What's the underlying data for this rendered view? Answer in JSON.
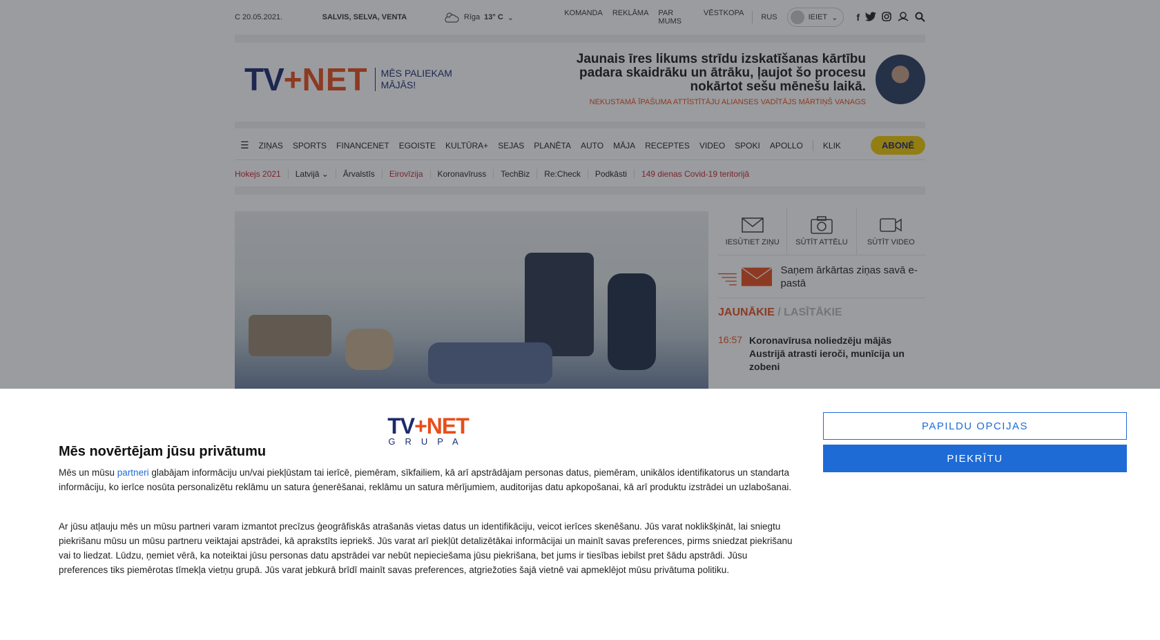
{
  "topbar": {
    "date": "C 20.05.2021.",
    "namedays": "SALVIS, SELVA, VENTA",
    "weather_city": "Rīga",
    "weather_temp": "13° C",
    "links": [
      "KOMANDA",
      "REKLĀMA",
      "PAR MUMS",
      "VĒSTKOPA"
    ],
    "lang": "RUS",
    "login": "IEIET"
  },
  "header": {
    "logo_tv": "TV",
    "logo_net": "NET",
    "tagline_1": "MĒS PALIEKAM",
    "tagline_2": "MĀJĀS!",
    "quote": "Jaunais īres likums strīdu izskatīšanas kārtību padara skaidrāku un ātrāku, ļaujot šo procesu nokārtot sešu mēnešu laikā.",
    "quote_author": "NEKUSTAMĀ ĪPAŠUMA ATTĪSTĪTĀJU ALIANSES VADĪTĀJS MĀRTIŅŠ VANAGS"
  },
  "nav": {
    "items": [
      "ZIŅAS",
      "SPORTS",
      "FINANCENET",
      "EGOISTE",
      "KULTŪRA+",
      "SEJAS",
      "PLANĒTA",
      "AUTO",
      "MĀJA",
      "RECEPTES",
      "VIDEO",
      "SPOKI",
      "APOLLO"
    ],
    "extra": "KLIK",
    "subscribe": "ABONĒ"
  },
  "subnav": {
    "items": [
      {
        "label": "Hokejs 2021",
        "highlight": true
      },
      {
        "label": "Latvijā ⌄",
        "highlight": false
      },
      {
        "label": "Ārvalstīs",
        "highlight": false
      },
      {
        "label": "Eirovīzija",
        "highlight": true
      },
      {
        "label": "Koronavīruss",
        "highlight": false
      },
      {
        "label": "TechBiz",
        "highlight": false
      },
      {
        "label": "Re:Check",
        "highlight": false
      },
      {
        "label": "Podkāsti",
        "highlight": false
      },
      {
        "label": "149 dienas Covid-19 teritorijā",
        "highlight": true
      }
    ]
  },
  "sidebar": {
    "send_news": "IESŪTIET ZIŅU",
    "send_photo": "SŪTĪT ATTĒLU",
    "send_video": "SŪTĪT VIDEO",
    "promo": "Saņem ārkārtas ziņas savā e-pastā",
    "tab_latest": "JAUNĀKIE",
    "tab_sep": " / ",
    "tab_read": "LASĪTĀKIE",
    "news": [
      {
        "time": "16:57",
        "headline": "Koronavīrusa noliedzēju mājās Austrijā atrasti ieroči, munīcija un zobeni"
      }
    ]
  },
  "consent": {
    "brand_logo_left": "TV",
    "brand_logo_right": "NET",
    "brand_sub": "GRUPA",
    "title": "Mēs novērtējam jūsu privātumu",
    "p1_before": "Mēs un mūsu ",
    "p1_link": "partneri",
    "p1_after": " glabājam informāciju un/vai piekļūstam tai ierīcē, piemēram, sīkfailiem, kā arī apstrādājam personas datus, piemēram, unikālos identifikatorus un standarta informāciju, ko ierīce nosūta personalizētu reklāmu un satura ģenerēšanai, reklāmu un satura mērījumiem, auditorijas datu apkopošanai, kā arī produktu izstrādei un uzlabošanai.",
    "p2": "Ar jūsu atļauju mēs un mūsu partneri varam izmantot precīzus ģeogrāfiskās atrašanās vietas datus un identifikāciju, veicot ierīces skenēšanu. Jūs varat noklikšķināt, lai sniegtu piekrišanu mūsu un mūsu partneru veiktajai apstrādei, kā aprakstīts iepriekš. Jūs varat arī piekļūt detalizētākai informācijai un mainīt savas preferences, pirms sniedzat piekrišanu vai to liedzat. Lūdzu, ņemiet vērā, ka noteiktai jūsu personas datu apstrādei var nebūt nepieciešama jūsu piekrišana, bet jums ir tiesības iebilst pret šādu apstrādi. Jūsu preferences tiks piemērotas tīmekļa vietņu grupā. Jūs varat jebkurā brīdī mainīt savas preferences, atgriežoties šajā vietnē vai apmeklējot mūsu privātuma politiku.",
    "btn_options": "PAPILDU OPCIJAS",
    "btn_agree": "PIEKRĪTU"
  },
  "colors": {
    "brand_blue": "#1c2a6e",
    "brand_orange": "#e84e1b",
    "consent_blue": "#1e6bd6",
    "subscribe_yellow": "#f3c800"
  }
}
